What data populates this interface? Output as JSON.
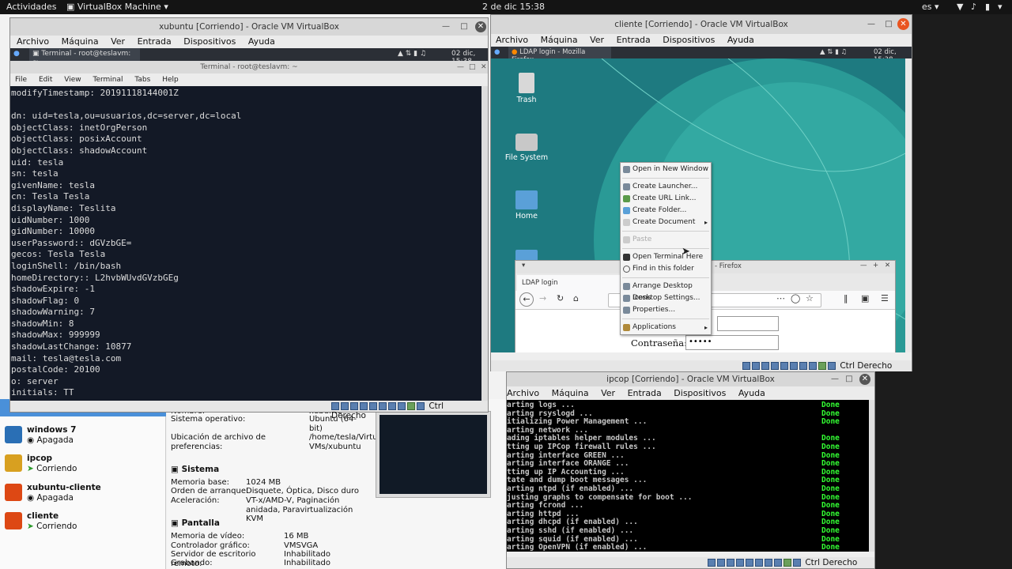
{
  "topbar": {
    "activities": "Actividades",
    "app": "VirtualBox Machine",
    "clock": "2 de dic 15:38",
    "lang": "es"
  },
  "xubuntu_window": {
    "title": "xubuntu [Corriendo] - Oracle VM VirtualBox",
    "menu": [
      "Archivo",
      "Máquina",
      "Ver",
      "Entrada",
      "Dispositivos",
      "Ayuda"
    ],
    "panel_task": "Terminal - root@teslavm: ~",
    "panel_clock": "02 dic, 15:38",
    "terminal_title": "Terminal - root@teslavm: ~",
    "terminal_menu": [
      "File",
      "Edit",
      "View",
      "Terminal",
      "Tabs",
      "Help"
    ],
    "lines": [
      "modifyTimestamp: 20191118144001Z",
      "",
      "dn: uid=tesla,ou=usuarios,dc=server,dc=local",
      "objectClass: inetOrgPerson",
      "objectClass: posixAccount",
      "objectClass: shadowAccount",
      "uid: tesla",
      "sn: tesla",
      "givenName: tesla",
      "cn: Tesla Tesla",
      "displayName: Teslita",
      "uidNumber: 1000",
      "gidNumber: 10000",
      "userPassword:: dGVzbGE=",
      "gecos: Tesla Tesla",
      "loginShell: /bin/bash",
      "homeDirectory:: L2hvbWUvdGVzbGEg",
      "shadowExpire: -1",
      "shadowFlag: 0",
      "shadowWarning: 7",
      "shadowMin: 8",
      "shadowMax: 999999",
      "shadowLastChange: 10877",
      "mail: tesla@tesla.com",
      "postalCode: 20100",
      "o: server",
      "initials: TT"
    ],
    "status_key": "Ctrl Derecho"
  },
  "manager": {
    "vms": [
      {
        "name": "windows 7",
        "state": "Apagada",
        "color": "#2a6fb5"
      },
      {
        "name": "ipcop",
        "state": "Corriendo",
        "color": "#d8a020"
      },
      {
        "name": "xubuntu-cliente",
        "state": "Apagada",
        "color": "#dd4814"
      },
      {
        "name": "cliente",
        "state": "Corriendo",
        "color": "#dd4814"
      }
    ],
    "partial_selected": "Corriendo",
    "general": {
      "k_name": "Nombre:",
      "v_name": "xubuntu",
      "k_os": "Sistema operativo:",
      "v_os": "Ubuntu (64-bit)",
      "k_pref": "Ubicación de archivo de preferencias:",
      "v_pref": "/home/tesla/VirtualBox VMs/xubuntu"
    },
    "sistema": {
      "title": "Sistema",
      "k_mem": "Memoria base:",
      "v_mem": "1024 MB",
      "k_boot": "Orden de arranque:",
      "v_boot": "Disquete, Óptica, Disco duro",
      "k_acc": "Aceleración:",
      "v_acc": "VT-x/AMD-V, Paginación anidada, Paravirtualización KVM"
    },
    "pantalla": {
      "title": "Pantalla",
      "k_vmem": "Memoria de vídeo:",
      "v_vmem": "16 MB",
      "k_ctrl": "Controlador gráfico:",
      "v_ctrl": "VMSVGA",
      "k_rdp": "Servidor de escritorio remoto:",
      "v_rdp": "Inhabilitado",
      "k_rec": "Grabando:",
      "v_rec": "Inhabilitado"
    }
  },
  "cliente_window": {
    "title": "cliente [Corriendo] - Oracle VM VirtualBox",
    "menu": [
      "Archivo",
      "Máquina",
      "Ver",
      "Entrada",
      "Dispositivos",
      "Ayuda"
    ],
    "panel_task": "LDAP login - Mozilla Firefox",
    "panel_clock": "02 dic, 15:38",
    "desktop_icons": [
      "Trash",
      "File System",
      "Home"
    ],
    "firefox": {
      "title_suffix": "- Firefox",
      "tab": "LDAP login",
      "password_label": "Contraseña:",
      "password_value": "•••••"
    },
    "context_menu": [
      {
        "label": "Open in New Window",
        "sub": false,
        "disabled": false
      },
      {
        "label": "Create Launcher...",
        "sub": false,
        "disabled": false
      },
      {
        "label": "Create URL Link...",
        "sub": false,
        "disabled": false
      },
      {
        "label": "Create Folder...",
        "sub": false,
        "disabled": false
      },
      {
        "label": "Create Document",
        "sub": true,
        "disabled": false
      },
      {
        "label": "Paste",
        "sub": false,
        "disabled": true
      },
      {
        "label": "Open Terminal Here",
        "sub": false,
        "disabled": false
      },
      {
        "label": "Find in this folder",
        "sub": false,
        "disabled": false
      },
      {
        "label": "Arrange Desktop Icons",
        "sub": false,
        "disabled": false
      },
      {
        "label": "Desktop Settings...",
        "sub": false,
        "disabled": false
      },
      {
        "label": "Properties...",
        "sub": false,
        "disabled": false
      },
      {
        "label": "Applications",
        "sub": true,
        "disabled": false
      }
    ],
    "status_key": "Ctrl Derecho"
  },
  "ipcop_window": {
    "title": "ipcop [Corriendo] - Oracle VM VirtualBox",
    "menu": [
      "Archivo",
      "Máquina",
      "Ver",
      "Entrada",
      "Dispositivos",
      "Ayuda"
    ],
    "rows": [
      {
        "text": "arting logs ...",
        "done": "Done"
      },
      {
        "text": "arting rsyslogd ...",
        "done": "Done"
      },
      {
        "text": "itializing Power Management ...",
        "done": "Done"
      },
      {
        "text": "arting network ...",
        "done": ""
      },
      {
        "text": "ading iptables helper modules ...",
        "done": "Done"
      },
      {
        "text": "tting up IPCop firewall rules ...",
        "done": "Done"
      },
      {
        "text": "arting interface GREEN ...",
        "done": "Done"
      },
      {
        "text": "arting interface ORANGE ...",
        "done": "Done"
      },
      {
        "text": "tting up IP Accounting ...",
        "done": "Done"
      },
      {
        "text": "tate and dump boot messages ...",
        "done": "Done"
      },
      {
        "text": "arting ntpd (if enabled) ...",
        "done": "Done"
      },
      {
        "text": "justing graphs to compensate for boot ...",
        "done": "Done"
      },
      {
        "text": "arting fcrond ...",
        "done": "Done"
      },
      {
        "text": "arting httpd ...",
        "done": "Done"
      },
      {
        "text": "arting dhcpd (if enabled) ...",
        "done": "Done"
      },
      {
        "text": "arting sshd (if enabled) ...",
        "done": "Done"
      },
      {
        "text": "arting squid (if enabled) ...",
        "done": "Done"
      },
      {
        "text": "arting OpenVPN (if enabled) ...",
        "done": "Done"
      }
    ],
    "status_key": "Ctrl Derecho"
  }
}
